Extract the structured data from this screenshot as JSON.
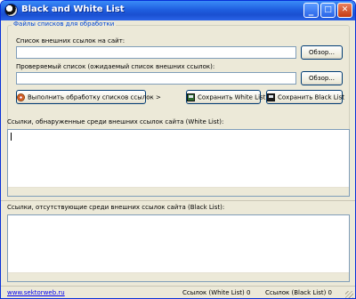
{
  "window": {
    "title": "Black and White List",
    "minimize_glyph": "_",
    "maximize_glyph": "□",
    "close_glyph": "✕"
  },
  "group": {
    "legend": "Файлы списков для обработки",
    "external_links_label": "Список внешних ссылок на сайт:",
    "external_links_value": "",
    "checked_list_label": "Проверяемый список (ожидаемый список внешних ссылок):",
    "checked_list_value": "",
    "browse_label": "Обзор...",
    "process_button": "Выполнить обработку списков ссылок >",
    "save_white": "Сохранить White List",
    "save_black": "Сохранить Black List"
  },
  "white_list": {
    "label": "Ссылки, обнаруженные среди внешних ссылок сайта (White List):",
    "value": ""
  },
  "black_list": {
    "label": "Ссылки, отсутствующие среди внешних ссылок сайта (Black List):",
    "value": ""
  },
  "status": {
    "website": "www.sektorweb.ru",
    "white_count": "Ссылок (White List) 0",
    "black_count": "Ссылок (Black List) 0"
  },
  "icons": [
    "yin-yang-app-icon",
    "gear-icon",
    "save-white-icon",
    "save-black-icon"
  ],
  "colors": {
    "title_bar": "#2a64e8",
    "group_legend": "#0046d5",
    "link": "#0000ee",
    "window_bg": "#ece9d8"
  }
}
